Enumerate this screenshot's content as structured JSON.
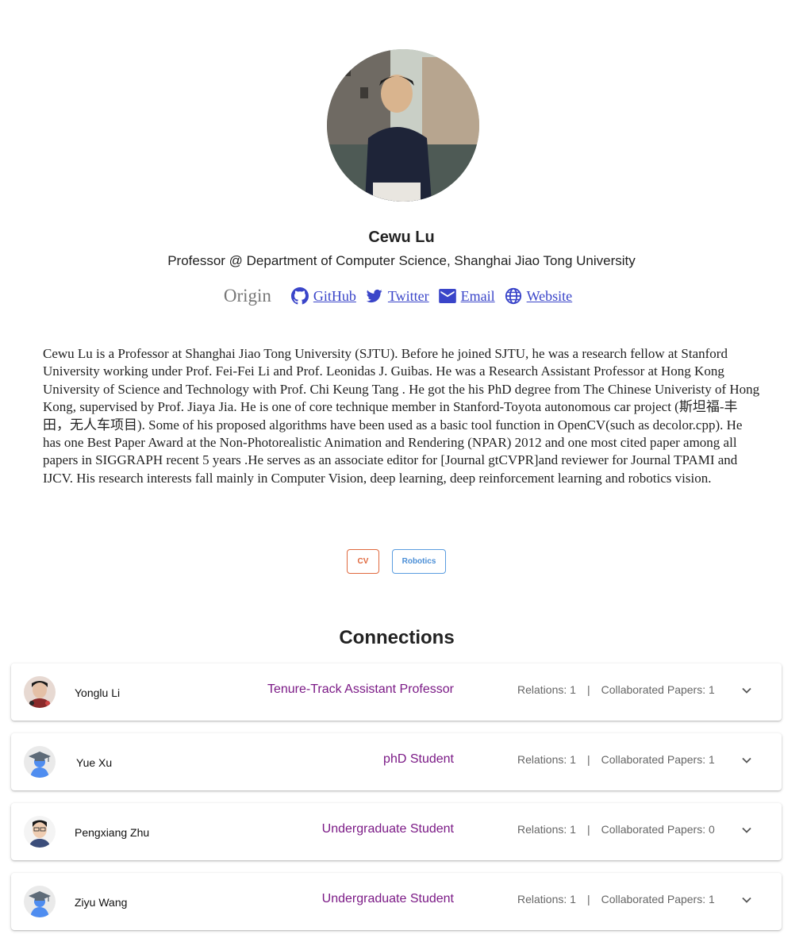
{
  "profile": {
    "name": "Cewu Lu",
    "title": "Professor @ Department of Computer Science, Shanghai Jiao Tong University",
    "avatar_icon": "profile-photo"
  },
  "links": {
    "origin": "Origin",
    "github": "GitHub",
    "twitter": "Twitter",
    "email": "Email",
    "website": "Website"
  },
  "bio": "Cewu Lu is a Professor at Shanghai Jiao Tong University (SJTU). Before he joined SJTU, he was a research fellow at Stanford University working under Prof. Fei-Fei Li and Prof. Leonidas J. Guibas. He was a Research Assistant Professor at Hong Kong University of Science and Technology with Prof. Chi Keung Tang . He got the his PhD degree from The Chinese Univeristy of Hong Kong, supervised by Prof. Jiaya Jia. He is one of core technique member in Stanford-Toyota autonomous car project (斯坦福-丰田，无人车项目). Some of his proposed algorithms have been used as a basic tool function in OpenCV(such as decolor.cpp). He has one Best Paper Award at the Non-Photorealistic Animation and Rendering (NPAR) 2012 and one most cited paper among all papers in SIGGRAPH recent 5 years .He serves as an associate editor for [Journal gtCVPR]and reviewer for Journal TPAMI and IJCV. His research interests fall mainly in Computer Vision, deep learning, deep reinforcement learning and robotics vision.",
  "tags": {
    "cv": "CV",
    "robotics": "Robotics"
  },
  "colors": {
    "link": "#3a45c9",
    "role": "#7b1a86",
    "tag_cv": "#e0693e",
    "tag_robotics": "#4a8ed6"
  },
  "connections": {
    "heading": "Connections",
    "items": [
      {
        "name": "Yonglu Li",
        "role": "Tenure-Track Assistant Professor",
        "relations": "Relations: 1",
        "sep": "|",
        "papers": "Collaborated Papers: 1",
        "avatar": "photo"
      },
      {
        "name": "Yue Xu",
        "role": "phD Student",
        "relations": "Relations: 1",
        "sep": "|",
        "papers": "Collaborated Papers: 1",
        "avatar": "graduate-cap-placeholder"
      },
      {
        "name": "Pengxiang Zhu",
        "role": "Undergraduate Student",
        "relations": "Relations: 1",
        "sep": "|",
        "papers": "Collaborated Papers: 0",
        "avatar": "photo"
      },
      {
        "name": "Ziyu Wang",
        "role": "Undergraduate Student",
        "relations": "Relations: 1",
        "sep": "|",
        "papers": "Collaborated Papers: 1",
        "avatar": "graduate-cap-placeholder"
      }
    ]
  }
}
